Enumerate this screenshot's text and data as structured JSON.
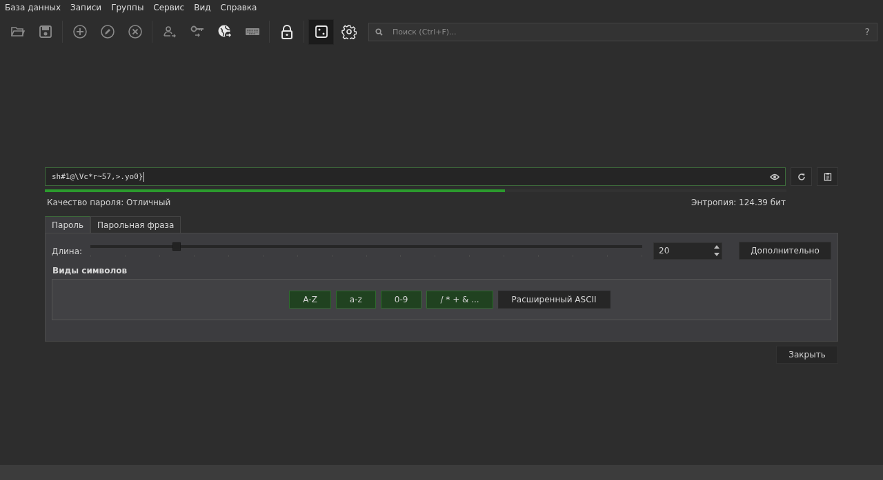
{
  "menu": [
    "База данных",
    "Записи",
    "Группы",
    "Сервис",
    "Вид",
    "Справка"
  ],
  "toolbar": [
    {
      "kind": "folder",
      "disabled": true,
      "selected": false
    },
    {
      "kind": "save",
      "disabled": true,
      "selected": false
    },
    {
      "kind": "sep"
    },
    {
      "kind": "add",
      "disabled": true,
      "selected": false
    },
    {
      "kind": "edit",
      "disabled": true,
      "selected": false
    },
    {
      "kind": "delete",
      "disabled": true,
      "selected": false
    },
    {
      "kind": "sep"
    },
    {
      "kind": "user",
      "disabled": true,
      "selected": false
    },
    {
      "kind": "key",
      "disabled": true,
      "selected": false
    },
    {
      "kind": "globe",
      "disabled": false,
      "selected": false
    },
    {
      "kind": "keyboard",
      "disabled": true,
      "selected": false
    },
    {
      "kind": "sep"
    },
    {
      "kind": "lock",
      "disabled": false,
      "selected": false
    },
    {
      "kind": "sep"
    },
    {
      "kind": "dice",
      "disabled": false,
      "selected": true
    },
    {
      "kind": "gear",
      "disabled": false,
      "selected": false
    }
  ],
  "search": {
    "placeholder": "Поиск (Ctrl+F)...",
    "help": "?"
  },
  "password": {
    "value": "sh#1@\\Vc*r~57,>.yo0}",
    "strength": {
      "level": 0.62
    },
    "quality": "Качество пароля: Отличный",
    "entropy": "Энтропия: 124.39 бит"
  },
  "tabs": [
    {
      "label": "Пароль",
      "selected": true
    },
    {
      "label": "Парольная фраза",
      "selected": false
    }
  ],
  "length": {
    "label": "Длина:",
    "level": 0.156,
    "value": "20"
  },
  "advanced_button": "Дополнительно",
  "char_types": {
    "title": "Виды символов",
    "options": [
      {
        "label": "A-Z",
        "checked": true
      },
      {
        "label": "a-z",
        "checked": true
      },
      {
        "label": "0-9",
        "checked": true
      },
      {
        "label": "/ * + & ...",
        "checked": true
      },
      {
        "label": "Расширенный ASCII",
        "checked": false
      }
    ]
  },
  "close_button": "Закрыть"
}
